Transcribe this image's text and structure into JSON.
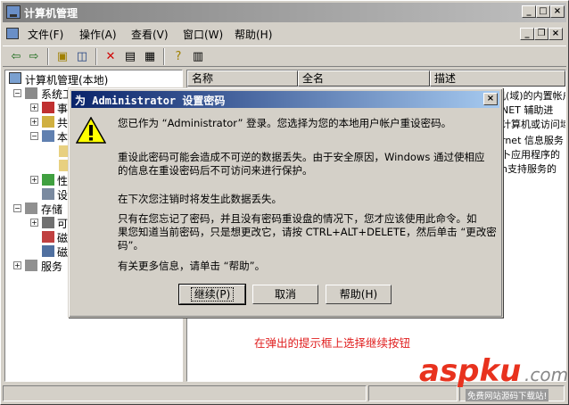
{
  "window": {
    "title": "计算机管理"
  },
  "menu": [
    {
      "label": "文件(F)"
    },
    {
      "label": "操作(A)"
    },
    {
      "label": "查看(V)"
    },
    {
      "label": "窗口(W)"
    },
    {
      "label": "帮助(H)"
    }
  ],
  "tree": {
    "root": "计算机管理(本地)",
    "items": [
      {
        "label": "系统工"
      },
      {
        "label": "事"
      },
      {
        "label": "共"
      },
      {
        "label": "本"
      },
      {
        "label": "性"
      },
      {
        "label": "设"
      },
      {
        "label": "存储"
      },
      {
        "label": "可"
      },
      {
        "label": "磁"
      },
      {
        "label": "磁"
      },
      {
        "label": "服务"
      }
    ]
  },
  "list": {
    "columns": [
      "名称",
      "全名",
      "描述"
    ],
    "rows": [
      {
        "desc": "管理计算机(域)的内置帐户"
      },
      {
        "desc": "NET 辅助进"
      },
      {
        "desc": "计算机或访问域"
      },
      {
        "desc": "rnet 信息服务"
      },
      {
        "desc": "卜应用程序的"
      },
      {
        "desc": "n支持服务的"
      }
    ]
  },
  "dialog": {
    "title": "为 Administrator 设置密码",
    "messages": [
      "您已作为 “Administrator” 登录。您选择为您的本地用户帐户重设密码。",
      "重设此密码可能会造成不可逆的数据丢失。由于安全原因，Windows 通过使相应",
      "的信息在重设密码后不可访问来进行保护。",
      "在下次您注销时将发生此数据丢失。",
      "只有在您忘记了密码，并且没有密码重设盘的情况下，您才应该使用此命令。如",
      "果您知道当前密码，只是想更改它，请按 CTRL+ALT+DELETE，然后单击 “更改密",
      "码”。",
      "有关更多信息，请单击 “帮助”。"
    ],
    "buttons": {
      "continue": "继续(P)",
      "cancel": "取消",
      "help": "帮助(H)"
    }
  },
  "annotation": "在弹出的提示框上选择继续按钮",
  "watermark": {
    "brand": "aspku",
    "tld": ".com",
    "tagline": "免费网站源码下载站!"
  },
  "colors": {
    "dialog_title": "#0a246a",
    "annotation": "#e02020",
    "watermark": "#e8321e"
  }
}
